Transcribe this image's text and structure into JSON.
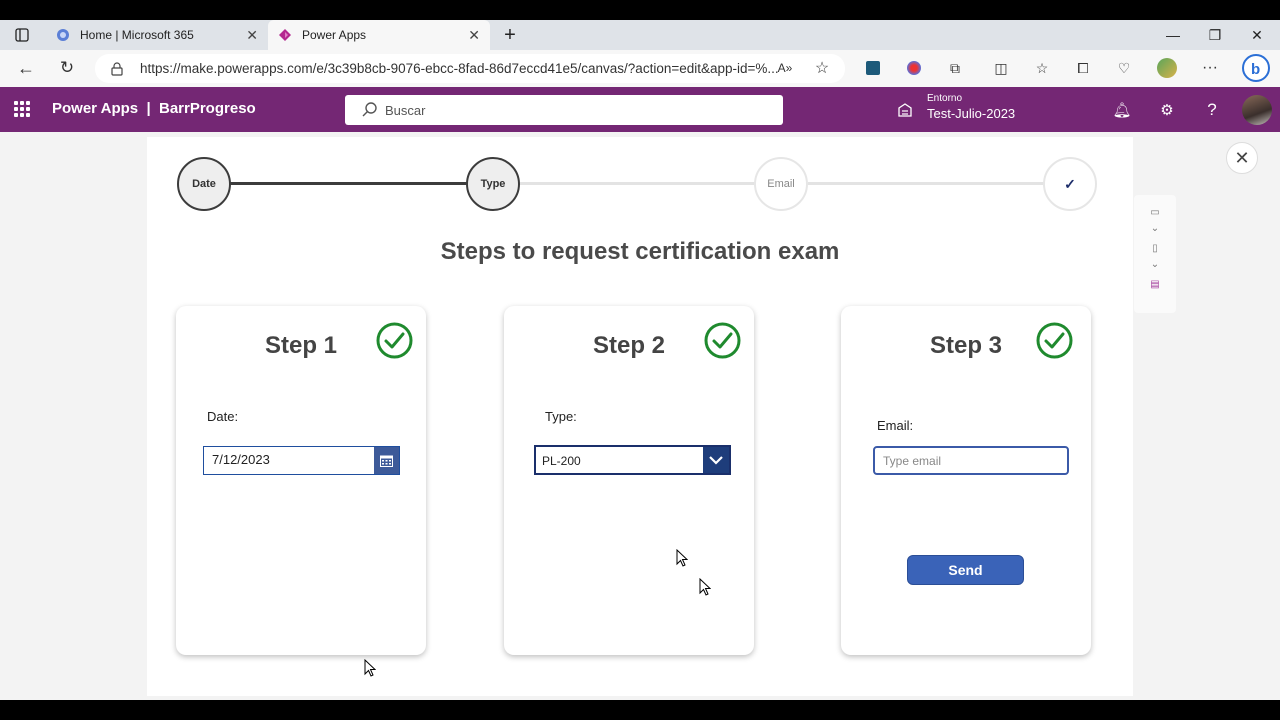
{
  "browser": {
    "tabs": [
      {
        "title": "Home | Microsoft 365",
        "favicon": "microsoft-365-icon",
        "active": false
      },
      {
        "title": "Power Apps",
        "favicon": "power-apps-icon",
        "active": true
      }
    ],
    "url": "https://make.powerapps.com/e/3c39b8cb-9076-ebcc-8fad-86d7eccd41e5/canvas/?action=edit&app-id=%...",
    "toolbar_icons": [
      "read-aloud-icon",
      "favorite-star-icon",
      "extension-icon",
      "extension-icon",
      "extensions-puzzle-icon",
      "split-screen-icon",
      "favorites-icon",
      "collections-icon",
      "browser-essentials-icon",
      "profile-icon",
      "more-icon",
      "bing-copilot-icon"
    ]
  },
  "powerapps": {
    "app_title": "Power Apps  |  BarrProgreso",
    "search_placeholder": "Buscar",
    "environment_label": "Entorno",
    "environment_name": "Test-Julio-2023"
  },
  "stepper": {
    "steps": [
      {
        "label": "Date",
        "done": true
      },
      {
        "label": "Type",
        "done": true
      },
      {
        "label": "Email",
        "done": false
      },
      {
        "label": "✓",
        "done": false
      }
    ]
  },
  "heading": "Steps to request certification exam",
  "cards": [
    {
      "title": "Step 1",
      "field_label": "Date:",
      "value": "7/12/2023",
      "completed": true
    },
    {
      "title": "Step 2",
      "field_label": "Type:",
      "value": "PL-200",
      "completed": true
    },
    {
      "title": "Step 3",
      "field_label": "Email:",
      "placeholder": "Type email",
      "button": "Send",
      "completed": true
    }
  ],
  "colors": {
    "header": "#742774",
    "check": "#1f8a2e",
    "send_button": "#3a63b8",
    "dropdown_chevron": "#1e3d7b"
  }
}
